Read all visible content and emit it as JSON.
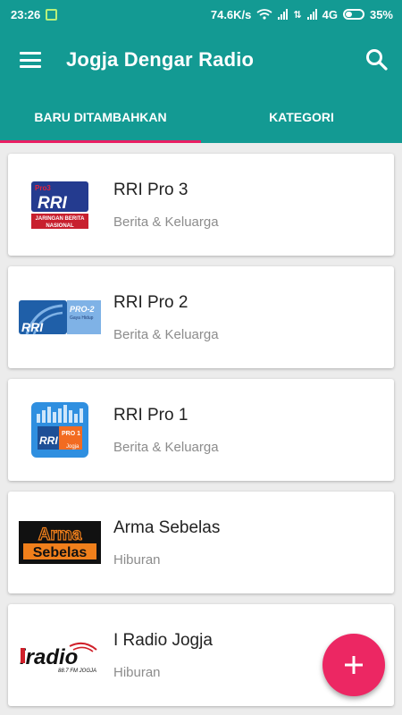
{
  "status_bar": {
    "time": "23:26",
    "speed": "74.6K/s",
    "network": "4G",
    "battery": "35%"
  },
  "app_bar": {
    "title": "Jogja Dengar Radio"
  },
  "tabs": [
    {
      "label": "BARU DITAMBAHKAN",
      "selected": true
    },
    {
      "label": "KATEGORI",
      "selected": false
    }
  ],
  "stations": [
    {
      "name": "RRI Pro 3",
      "category": "Berita & Keluarga",
      "logo_text": [
        "Pro3",
        "RRI",
        "JARINGAN BERITA",
        "NASIONAL"
      ]
    },
    {
      "name": "RRI Pro 2",
      "category": "Berita & Keluarga",
      "logo_text": [
        "RRI",
        "PRO-2",
        "Gaya Hidup"
      ]
    },
    {
      "name": "RRI Pro 1",
      "category": "Berita & Keluarga",
      "logo_text": [
        "RRI",
        "PRO 1",
        "Jogja"
      ]
    },
    {
      "name": "Arma Sebelas",
      "category": "Hiburan",
      "logo_text": [
        "Arma",
        "Sebelas"
      ]
    },
    {
      "name": "I Radio Jogja",
      "category": "Hiburan",
      "logo_text": [
        "iradio",
        "88.7 FM JOGJA"
      ]
    }
  ],
  "fab": {
    "icon": "plus-icon"
  },
  "colors": {
    "primary": "#139a93",
    "accent": "#ec2763",
    "background": "#ececec"
  }
}
